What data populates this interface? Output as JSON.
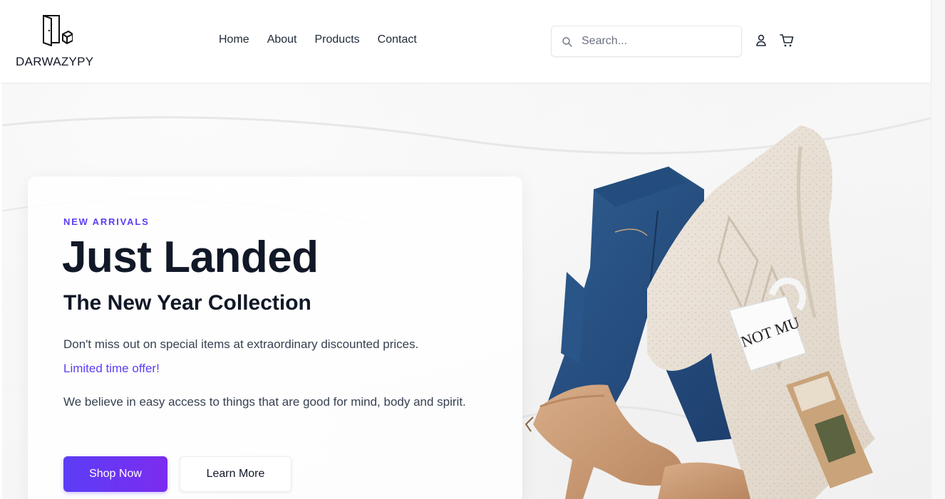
{
  "brand": {
    "name": "DARWAZYPY",
    "logo_icon": "door-with-box-icon"
  },
  "nav": {
    "items": [
      {
        "label": "Home"
      },
      {
        "label": "About"
      },
      {
        "label": "Products"
      },
      {
        "label": "Contact"
      }
    ]
  },
  "search": {
    "placeholder": "Search...",
    "value": "",
    "icon": "search-icon"
  },
  "header_actions": {
    "user_icon": "user-icon",
    "cart_icon": "cart-icon"
  },
  "hero": {
    "eyebrow": "NEW ARRIVALS",
    "headline": "Just Landed",
    "subheadline": "The New Year Collection",
    "description": "Don't miss out on special items at extraordinary discounted prices.",
    "offer": "Limited time offer!",
    "belief": "We believe in easy access to things that are good for mind, body and spirit.",
    "primary_button": "Shop Now",
    "secondary_button": "Learn More",
    "image": {
      "mug_text": "NOT MUCH"
    }
  },
  "colors": {
    "accent": "#5b3df5",
    "accent_end": "#7c2cf0",
    "heading": "#111827",
    "body_text": "#374151"
  }
}
